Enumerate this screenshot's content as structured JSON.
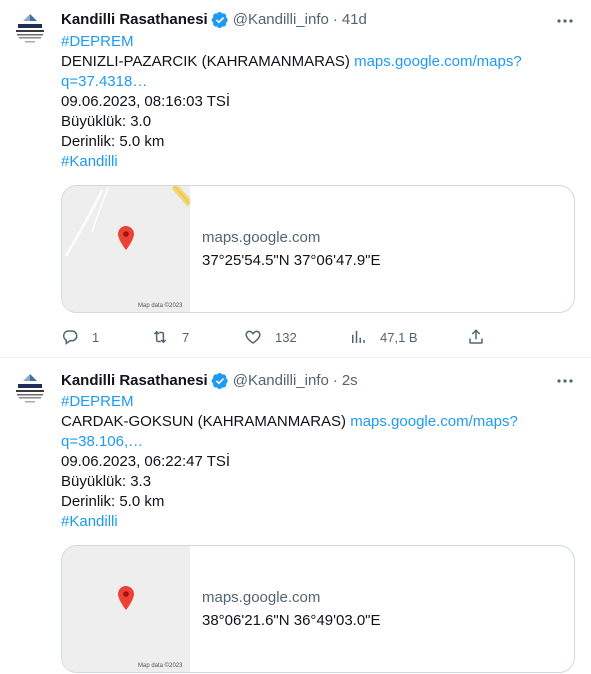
{
  "tweets": [
    {
      "author_name": "Kandilli Rasathanesi",
      "handle": "@Kandilli_info",
      "separator": "·",
      "time": "41d",
      "hashtag1": "#DEPREM",
      "location": "DENIZLI-PAZARCIK (KAHRAMANMARAS)",
      "link_part1": "maps.google.com/maps?",
      "link_part2": "q=37.4318…",
      "datetime": "09.06.2023, 08:16:03 TSİ",
      "magnitude": "Büyüklük: 3.0",
      "depth": "Derinlik: 5.0 km",
      "hashtag2": "#Kandilli",
      "card": {
        "domain": "maps.google.com",
        "title": "37°25'54.5\"N 37°06'47.9\"E",
        "map_credit": "Map data ©2023"
      },
      "actions": {
        "replies": "1",
        "retweets": "7",
        "likes": "132",
        "views": "47,1 B"
      }
    },
    {
      "author_name": "Kandilli Rasathanesi",
      "handle": "@Kandilli_info",
      "separator": "·",
      "time": "2s",
      "hashtag1": "#DEPREM",
      "location": "CARDAK-GOKSUN (KAHRAMANMARAS)",
      "link_part1": "maps.google.com/maps?",
      "link_part2": "q=38.106,…",
      "datetime": "09.06.2023, 06:22:47 TSİ",
      "magnitude": "Büyüklük: 3.3",
      "depth": "Derinlik: 5.0 km",
      "hashtag2": "#Kandilli",
      "card": {
        "domain": "maps.google.com",
        "title": "38°06'21.6\"N 36°49'03.0\"E",
        "map_credit": "Map data ©2023"
      }
    }
  ],
  "avatar_logo_text": "KANDILLI",
  "colors": {
    "link": "#1d9bf0",
    "verified": "#1d9bf0",
    "muted": "#536471",
    "map_pin": "#ea4335",
    "border": "#cfd9de"
  },
  "icons": {
    "reply": "reply-icon",
    "retweet": "retweet-icon",
    "like": "heart-icon",
    "views": "views-icon",
    "share": "share-icon",
    "verified": "verified-badge-icon",
    "more": "more-options-icon",
    "map_pin": "map-pin-icon"
  }
}
